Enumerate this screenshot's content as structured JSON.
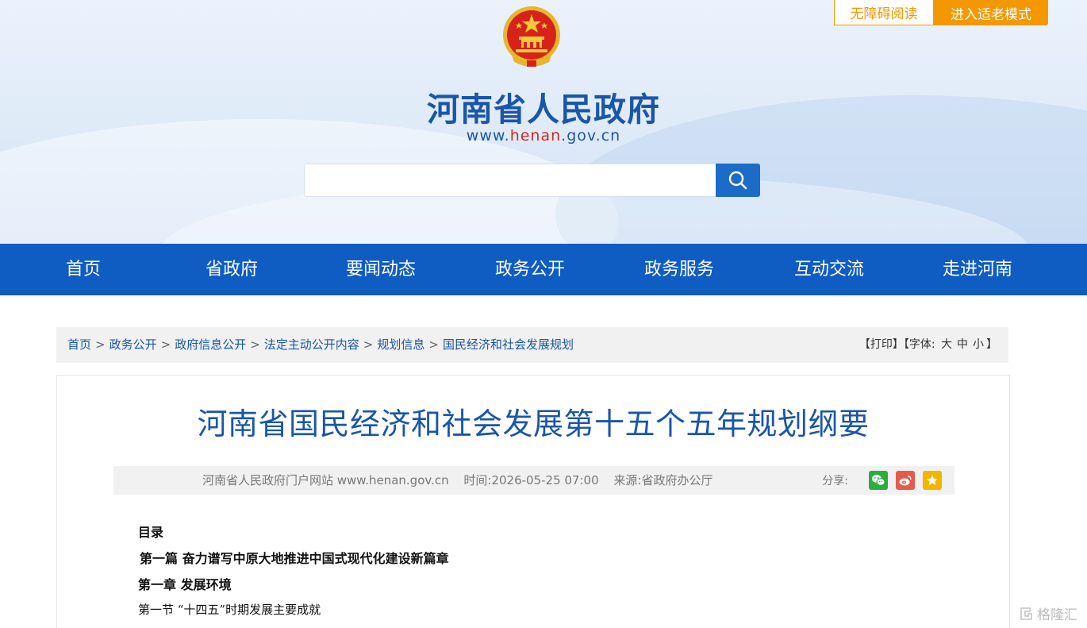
{
  "header": {
    "accessibility_label": "无障碍阅读",
    "elder_mode_label": "进入适老模式",
    "site_title": "河南省人民政府",
    "site_url_prefix": "www.",
    "site_url_highlight": "henan",
    "site_url_suffix": ".gov.cn",
    "search_placeholder": ""
  },
  "nav": {
    "items": [
      "首页",
      "省政府",
      "要闻动态",
      "政务公开",
      "政务服务",
      "互动交流",
      "走进河南"
    ]
  },
  "breadcrumb": {
    "items": [
      "首页",
      "政务公开",
      "政府信息公开",
      "法定主动公开内容",
      "规划信息",
      "国民经济和社会发展规划"
    ],
    "separator": ">"
  },
  "tools": {
    "print_label": "【打印】",
    "font_label": "【字体:",
    "size_large": "大",
    "size_medium": "中",
    "size_small": "小",
    "font_close": "】"
  },
  "article": {
    "title": "河南省国民经济和社会发展第十五个五年规划纲要",
    "source_site": "河南省人民政府门户网站 www.henan.gov.cn",
    "time": "时间:2026-05-25 07:00",
    "origin": "来源:省政府办公厅",
    "share_label": "分享:",
    "content": {
      "toc_heading": "目录",
      "part_one": "第一篇 奋力谱写中原大地推进中国式现代化建设新篇章",
      "chapter_one": "第一章 发展环境",
      "section_one": "第一节 “十四五”时期发展主要成就"
    }
  },
  "colors": {
    "primary_blue": "#0f5cc2",
    "title_blue": "#1a56a8",
    "accent_orange": "#f39800",
    "wechat_green": "#2aae3e",
    "weibo_red": "#e65a4a",
    "favorite_yellow": "#f4b400"
  },
  "icons": [
    "national-emblem-icon",
    "search-icon",
    "wechat-icon",
    "weibo-icon",
    "favorite-star-icon"
  ],
  "watermark": "格隆汇"
}
